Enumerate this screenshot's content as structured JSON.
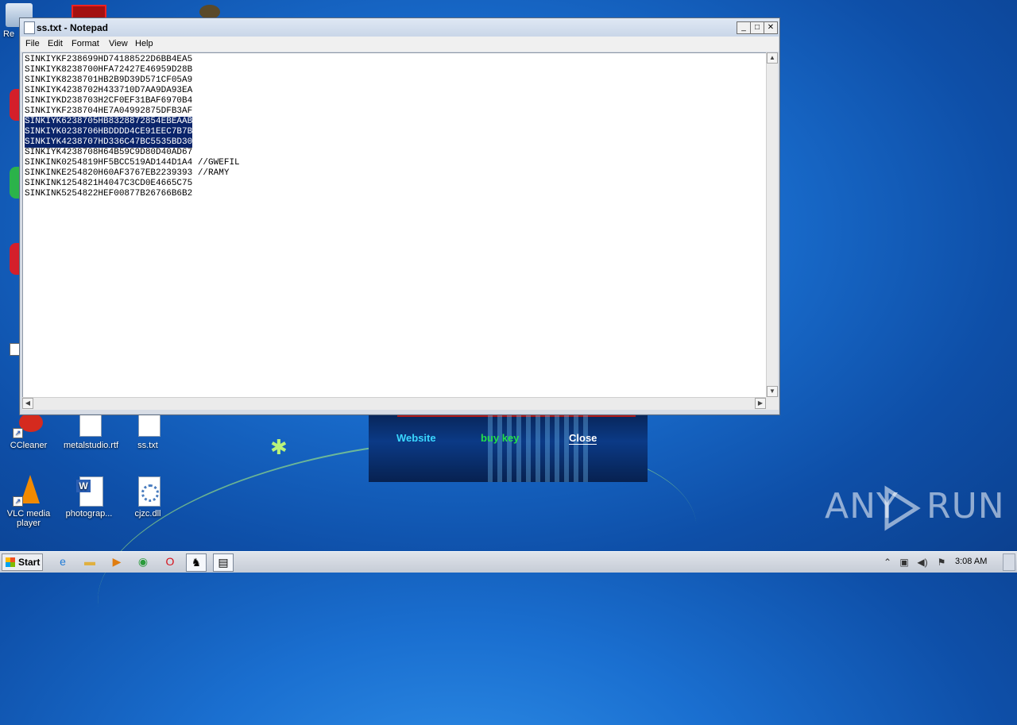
{
  "desktop": {
    "icons": [
      {
        "label": "CCleaner"
      },
      {
        "label": "metalstudio.rtf"
      },
      {
        "label": "ss.txt"
      },
      {
        "label": "VLC media player"
      },
      {
        "label": "photograp..."
      },
      {
        "label": "cjzc.dll"
      }
    ],
    "edge_fragment": "Re"
  },
  "notepad": {
    "title": "ss.txt - Notepad",
    "menu": [
      "File",
      "Edit",
      "Format",
      "View",
      "Help"
    ],
    "lines": [
      {
        "text": "SINKIYKF238699HD74188522D6BB4EA5",
        "selected": false
      },
      {
        "text": "SINKIYK8238700HFA72427E46959D28B",
        "selected": false
      },
      {
        "text": "SINKIYK8238701HB2B9D39D571CF05A9",
        "selected": false
      },
      {
        "text": "SINKIYK4238702H433710D7AA9DA93EA",
        "selected": false
      },
      {
        "text": "SINKIYKD238703H2CF0EF31BAF6970B4",
        "selected": false
      },
      {
        "text": "SINKIYKF238704HE7A04992875DFB3AF",
        "selected": false
      },
      {
        "text": "SINKIYK6238705HB8328872854EBEAAB",
        "selected": true
      },
      {
        "text": "SINKIYK0238706HBDDDD4CE91EEC7B7B",
        "selected": true
      },
      {
        "text": "SINKIYK4238707HD336C47BC5535BD30",
        "selected": true
      },
      {
        "text": "SINKIYK4238708H64B59C9D80D40AD67",
        "selected": false
      },
      {
        "text": "SINKINK0254819HF5BCC519AD144D1A4 //GWEFIL",
        "selected": false
      },
      {
        "text": "SINKINKE254820H60AF3767EB2239393 //RAMY",
        "selected": false
      },
      {
        "text": "SINKINK1254821H4047C3CD0E4665C75",
        "selected": false
      },
      {
        "text": "SINKINK5254822HEF00877B26766B6B2",
        "selected": false
      }
    ]
  },
  "popup": {
    "website": "Website",
    "buy_key": "buy key",
    "close": "Close",
    "colors": {
      "website": "#3ad7ff",
      "buy_key": "#22e04a",
      "close": "#ffffff"
    }
  },
  "taskbar": {
    "start": "Start",
    "clock": "3:08 AM"
  },
  "watermark": {
    "left": "ANY",
    "right": "RUN"
  }
}
